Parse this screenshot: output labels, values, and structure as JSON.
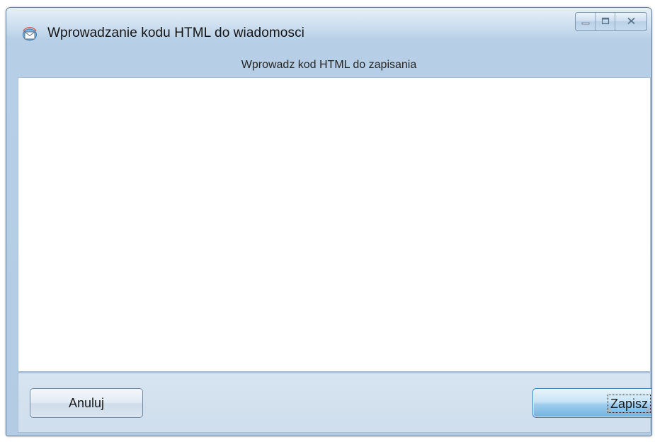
{
  "window": {
    "title": "Wprowadzanie kodu HTML do wiadomosci",
    "icon": "mail-envelope-icon",
    "caption_buttons": [
      "minimize-icon",
      "maximize-icon",
      "close-icon"
    ]
  },
  "dialog": {
    "subtitle": "Wprowadz kod HTML do zapisania",
    "html_input_value": ""
  },
  "buttons": {
    "cancel_label": "Anuluj",
    "save_label": "Zapisz"
  },
  "colors": {
    "frame": "#b6cfe6",
    "accent_button": "#6fb2df",
    "content_background": "#ffffff"
  }
}
